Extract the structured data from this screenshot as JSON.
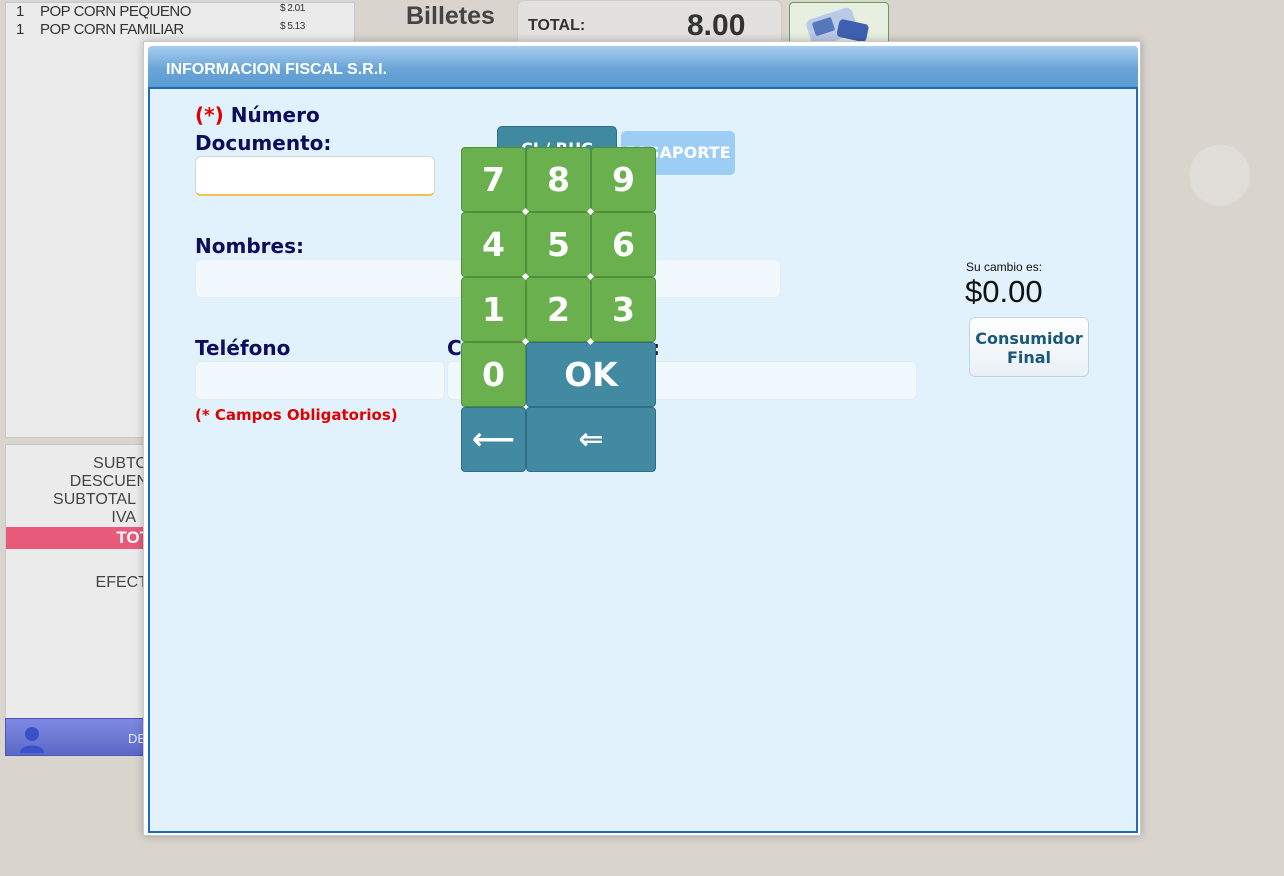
{
  "ticket": {
    "items": [
      {
        "qty": "1",
        "name": "POP CORN PEQUENO",
        "price": "$ 2.01"
      },
      {
        "qty": "1",
        "name": "POP CORN FAMILIAR",
        "price": "$ 5.13"
      }
    ]
  },
  "totals": {
    "subtotal_label": "SUBTO",
    "descuento_label": "DESCUEN",
    "subtotal2_label": "SUBTOTAL",
    "iva_label": "IVA",
    "total_label": "TOT",
    "efectivo_label": "EFECT",
    "user_text": "DE"
  },
  "header": {
    "billetes": "Billetes",
    "total_label": "TOTAL:",
    "total_value": "8.00"
  },
  "modal": {
    "title": "INFORMACION FISCAL S.R.I.",
    "required_mark": "(*)",
    "numero_label": "Número",
    "documento_label": "Documento:",
    "cedula_button": "CI / RUC",
    "pasaporte_button": "PASAPORTE",
    "nombres_label": "Nombres:",
    "telefono_label": "Teléfono",
    "correo_label_start": "C",
    "correo_label_end": ":",
    "required_note": "(* Campos Obligatorios)",
    "cambio_label": "Su cambio es:",
    "cambio_value": "$0.00",
    "consumidor_final_line1": "Consumidor",
    "consumidor_final_line2": "Final",
    "documento_value": "",
    "nombres_value": "",
    "telefono_value": "",
    "correo_value": ""
  },
  "keypad": {
    "k7": "7",
    "k8": "8",
    "k9": "9",
    "k4": "4",
    "k5": "5",
    "k6": "6",
    "k1": "1",
    "k2": "2",
    "k3": "3",
    "k0": "0",
    "ok": "OK",
    "backspace": "⟵",
    "clear": "⇐"
  },
  "colors": {
    "keypad_number": "#6ab04f",
    "keypad_action": "#428aa2",
    "modal_header": "#6aa5d8",
    "label_navy": "#0d0d5e",
    "required_red": "#e00000",
    "total_bar": "#e85a7a"
  }
}
